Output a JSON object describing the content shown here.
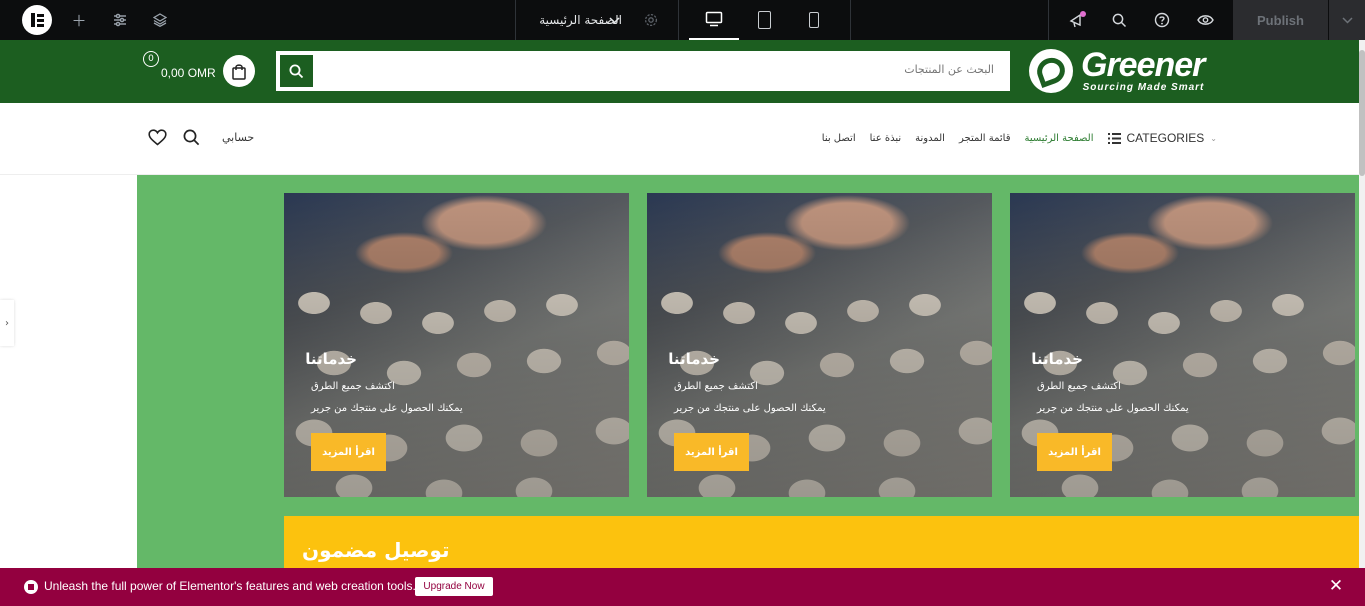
{
  "editor": {
    "page_name": "الصفحة الرئيسية",
    "publish_label": "Publish"
  },
  "header": {
    "logo_name": "Greener",
    "logo_tagline": "Sourcing Made Smart",
    "search_placeholder": "البحث عن المنتجات",
    "cart_count": "0",
    "cart_total": "0,00 OMR"
  },
  "nav": {
    "categories_label": "CATEGORIES",
    "items": [
      "الصفحة الرئيسية",
      "قائمة المتجر",
      "المدونة",
      "نبذة عنا",
      "اتصل بنا"
    ],
    "account_label": "حسابي"
  },
  "cards": [
    {
      "title": "خدماتنا",
      "line1": "اكتشف جميع الطرق",
      "line2": "يمكنك الحصول على منتجك من جرير",
      "button": "اقرأ المزيد"
    },
    {
      "title": "خدماتنا",
      "line1": "اكتشف جميع الطرق",
      "line2": "يمكنك الحصول على منتجك من جرير",
      "button": "اقرأ المزيد"
    },
    {
      "title": "خدماتنا",
      "line1": "اكتشف جميع الطرق",
      "line2": "يمكنك الحصول على منتجك من جرير",
      "button": "اقرأ المزيد"
    }
  ],
  "section": {
    "title": "توصيل مضمون"
  },
  "promo": {
    "text": "Unleash the full power of Elementor's features and web creation tools.",
    "button": "Upgrade Now"
  },
  "colors": {
    "brand_green": "#1c5e20",
    "section_green": "#64b868",
    "accent_yellow": "#fcc20e",
    "button_orange": "#f9b928",
    "promo_bg": "#93003f"
  }
}
